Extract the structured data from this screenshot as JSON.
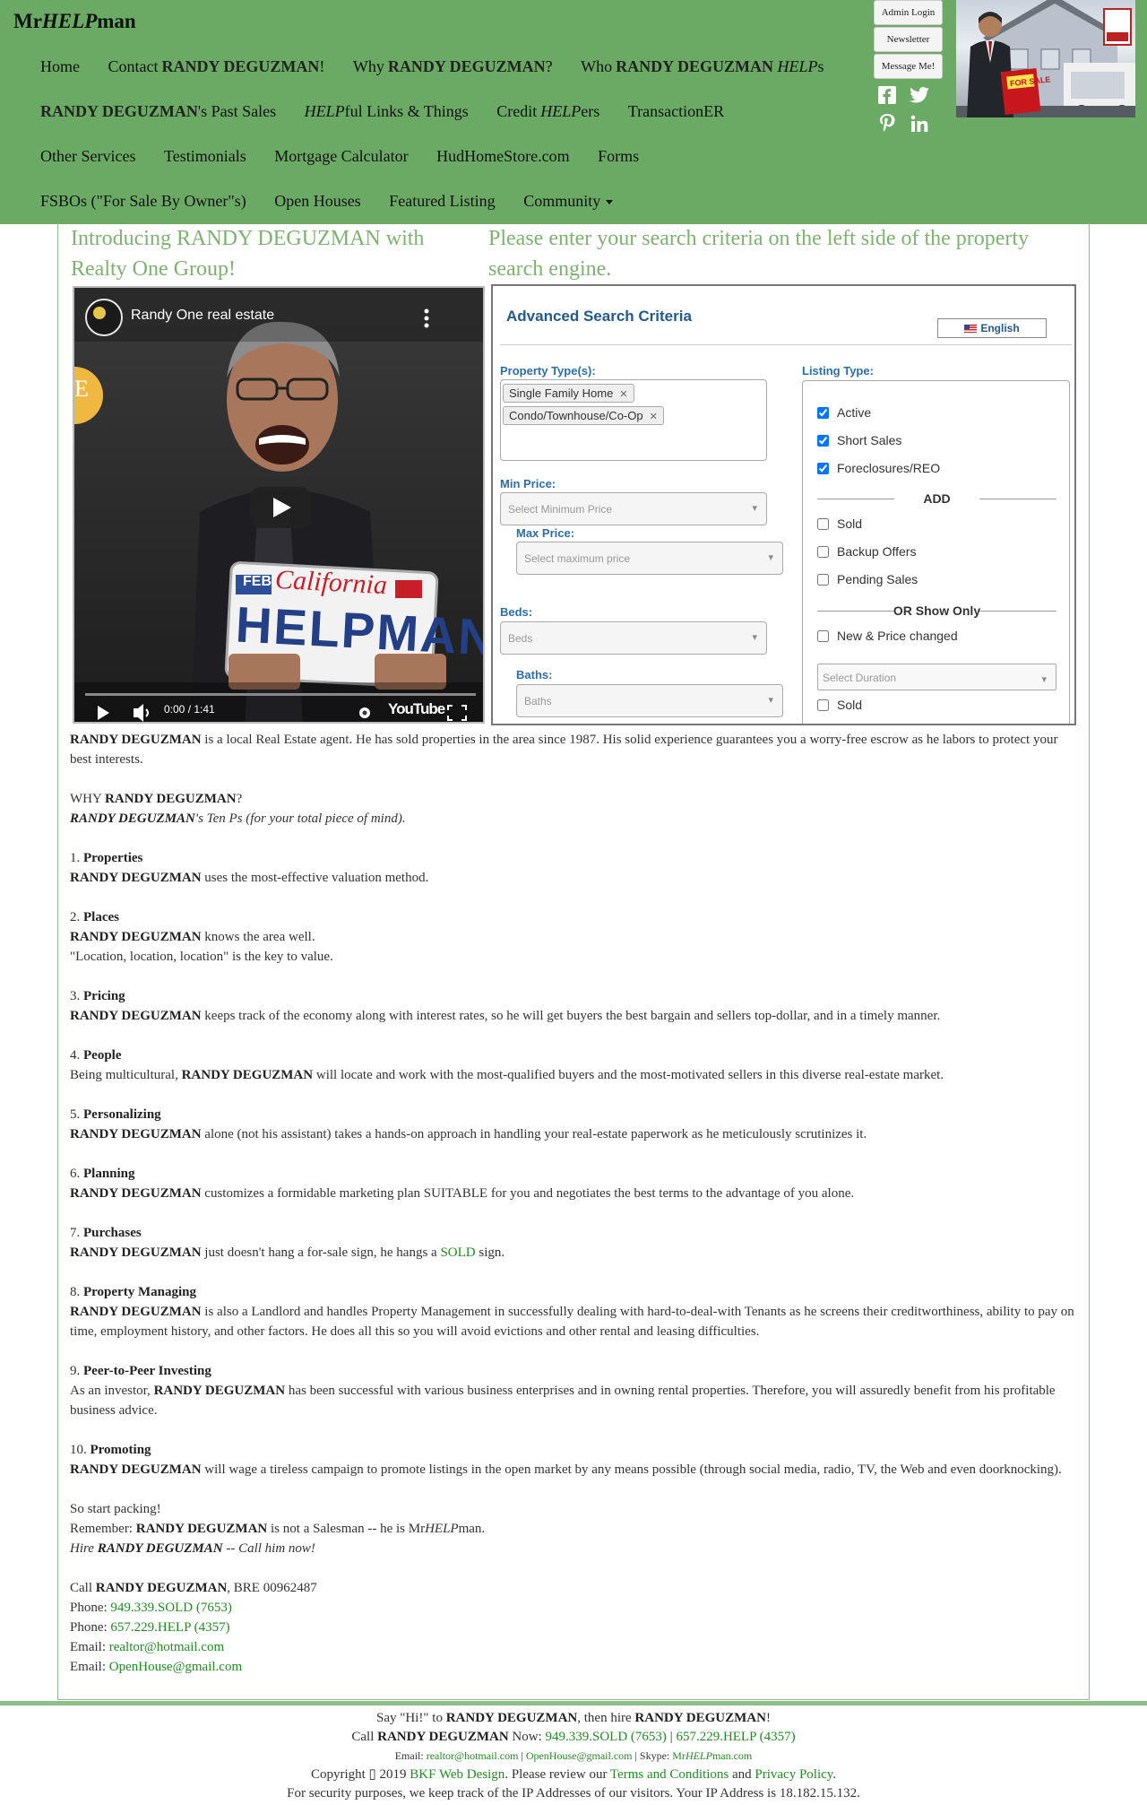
{
  "header": {
    "brand_pre": "Mr",
    "brand_em": "HELP",
    "brand_post": "man",
    "nav": {
      "home": "Home",
      "contact_pre": "Contact ",
      "contact_name": "RANDY DEGUZMAN",
      "contact_post": "!",
      "why_pre": "Why ",
      "why_name": "RANDY DEGUZMAN",
      "why_post": "?",
      "who_pre": "Who ",
      "who_name": "RANDY DEGUZMAN",
      "who_em": "HELP",
      "who_post": "s",
      "past_name": "RANDY DEGUZMAN",
      "past_post": "'s Past Sales",
      "links_em": "HELP",
      "links_post": "ful Links & Things",
      "credit_pre": "Credit ",
      "credit_em": "HELP",
      "credit_post": "ers",
      "transaction": "TransactionER",
      "other": "Other Services",
      "testimonials": "Testimonials",
      "mortgage": "Mortgage Calculator",
      "hud": "HudHomeStore.com",
      "forms": "Forms",
      "fsbo": "FSBOs (\"For Sale By Owner\"s)",
      "open_houses": "Open Houses",
      "featured": "Featured Listing",
      "community": "Community"
    },
    "buttons": {
      "admin": "Admin Login",
      "newsletter": "Newsletter",
      "message": "Message Me!"
    },
    "photo_sign": "FOR SALE"
  },
  "intro": {
    "left_heading": "Introducing RANDY DEGUZMAN with Realty One Group!",
    "right_heading": "Please enter your search criteria on the left side of the property search engine."
  },
  "video": {
    "title": "Randy One real estate",
    "plate_top": "California",
    "plate_month": "FEB",
    "plate_text": "HELPMAN",
    "time": "0:00 / 1:41",
    "brand": "YouTube",
    "side_letter": "E"
  },
  "search": {
    "title": "Advanced Search Criteria",
    "lang": "English",
    "property_types_label": "Property Type(s):",
    "property_types": [
      "Single Family Home",
      "Condo/Townhouse/Co-Op"
    ],
    "min_price_label": "Min Price:",
    "min_price_placeholder": "Select Minimum Price",
    "max_price_label": "Max Price:",
    "max_price_placeholder": "Select maximum price",
    "beds_label": "Beds:",
    "beds_placeholder": "Beds",
    "baths_label": "Baths:",
    "baths_placeholder": "Baths",
    "listing_type_label": "Listing Type:",
    "listing": [
      "Active",
      "Short Sales",
      "Foreclosures/REO"
    ],
    "add_label": "ADD",
    "add": [
      "Sold",
      "Backup Offers",
      "Pending Sales"
    ],
    "or_label": "OR Show Only",
    "new_price": "New & Price changed",
    "duration_placeholder": "Select Duration",
    "sold2": "Sold"
  },
  "body": {
    "name": "RANDY DEGUZMAN",
    "intro": " is a local Real Estate agent. He has sold properties in the area since 1987. His solid experience guarantees you a worry-free escrow as he labors to protect your best interests.",
    "why_pre": "WHY ",
    "why_post": "?",
    "tenps_post": "'s Ten Ps (for your total piece of mind).",
    "items": [
      {
        "num": "1. ",
        "title": "Properties",
        "lines": [
          " uses the most-effective valuation method."
        ]
      },
      {
        "num": "2. ",
        "title": "Places",
        "lines": [
          " knows the area well."
        ],
        "extra": "\"Location, location, location\" is the key to value."
      },
      {
        "num": "3. ",
        "title": "Pricing",
        "lines": [
          " keeps track of the economy along with interest rates, so he will get buyers the best bargain and sellers top-dollar, and in a timely manner."
        ]
      },
      {
        "num": "4. ",
        "title": "People",
        "pre": "Being multicultural, ",
        "lines": [
          " will locate and work with the most-qualified buyers and the most-motivated sellers in this diverse real-estate market."
        ]
      },
      {
        "num": "5. ",
        "title": "Personalizing",
        "lines": [
          " alone (not his assistant) takes a hands-on approach in handling your real-estate paperwork as he meticulously scrutinizes it."
        ]
      },
      {
        "num": "6. ",
        "title": "Planning",
        "lines": [
          " customizes a formidable marketing plan SUITABLE for you and negotiates the best terms to the advantage of you alone."
        ]
      },
      {
        "num": "7. ",
        "title": "Purchases",
        "lines": [
          " just doesn't hang a for-sale sign, he hangs a "
        ],
        "link": "SOLD",
        "after": " sign."
      },
      {
        "num": "8. ",
        "title": "Property Managing",
        "lines": [
          " is also a Landlord and handles Property Management in successfully dealing with hard-to-deal-with Tenants as he screens their creditworthiness, ability to pay on time, employment history, and other factors. He does all this so you will avoid evictions and other rental and leasing difficulties."
        ]
      },
      {
        "num": "9. ",
        "title": "Peer-to-Peer Investing",
        "pre": "As an investor, ",
        "lines": [
          " has been successful with various business enterprises and in owning rental properties. Therefore, you will assuredly benefit from his profitable business advice."
        ]
      },
      {
        "num": "10. ",
        "title": "Promoting",
        "lines": [
          " will wage a tireless campaign to promote listings in the open market by any means possible (through social media, radio, TV, the Web and even doorknocking)."
        ]
      }
    ],
    "start": "So start packing!",
    "remember_pre": "Remember: ",
    "remember_mid": " is not a Salesman -- he is Mr",
    "remember_em": "HELP",
    "remember_post": "man.",
    "hire_pre": "Hire ",
    "hire_post": " -- Call him now!",
    "call_pre": "Call ",
    "call_post": ", BRE 00962487",
    "phone_label": "Phone: ",
    "phone1": "949.339.SOLD (7653)",
    "phone2": "657.229.HELP (4357)",
    "email_label": "Email: ",
    "email1": "realtor@hotmail.com",
    "email2": "OpenHouse@gmail.com"
  },
  "footer": {
    "hi_pre": "Say \"Hi!\" to ",
    "hi_mid": ", then hire ",
    "hi_post": "!",
    "call_pre": "Call ",
    "call_mid": " Now: ",
    "sep": " | ",
    "email_label": "Email: ",
    "skype_label": "Skype: ",
    "skype_pre": "Mr",
    "skype_em": "HELP",
    "skype_post": "man.com",
    "copy_pre": "Copyright ▯ 2019 ",
    "copy_link": "BKF Web Design",
    "copy_mid": ". Please review our ",
    "terms": "Terms and Conditions",
    "and": " and ",
    "privacy": "Privacy Policy",
    "dot": ".",
    "security": "For security purposes, we keep track of the IP Addresses of our visitors. Your IP Address is 18.182.15.132."
  }
}
